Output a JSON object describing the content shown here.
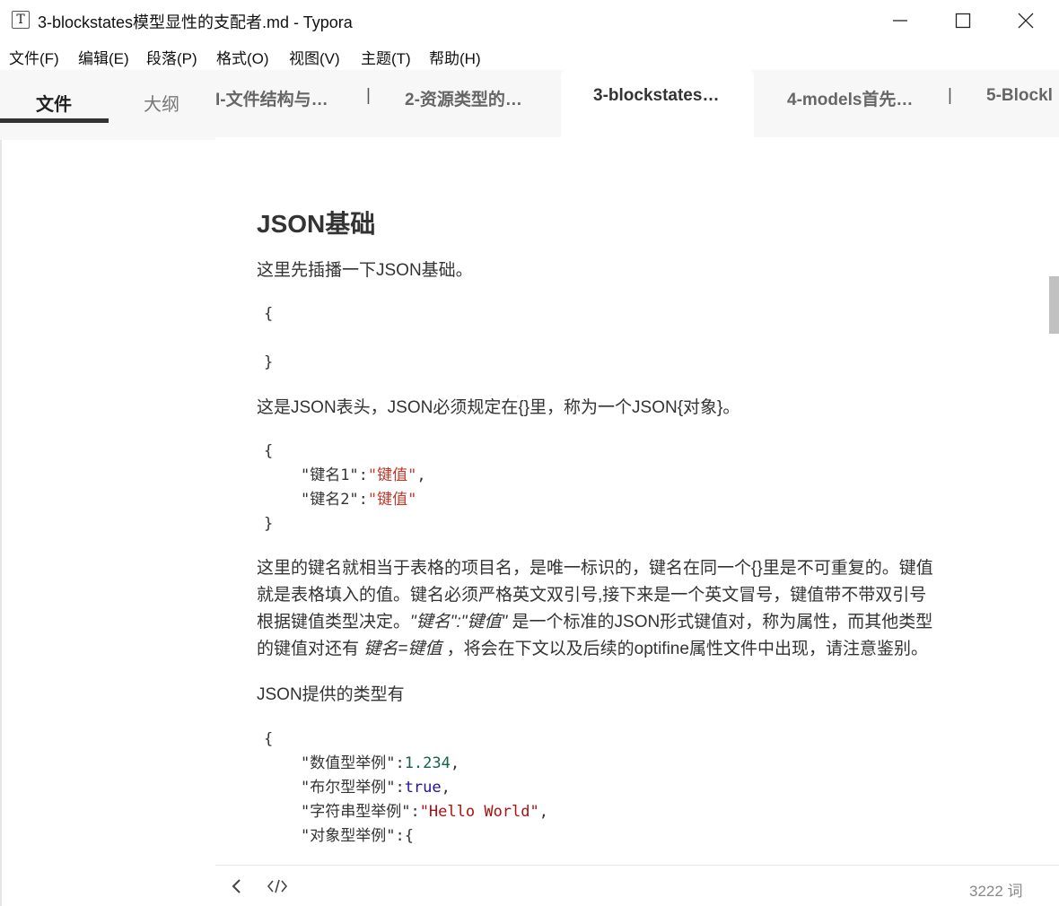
{
  "window": {
    "app_icon_letter": "T",
    "title": "3-blockstates模型显性的支配者.md - Typora"
  },
  "menu": [
    "文件(F)",
    "编辑(E)",
    "段落(P)",
    "格式(O)",
    "视图(V)",
    "主题(T)",
    "帮助(H)"
  ],
  "sidebar": {
    "tab_files": "文件",
    "tab_outline": "大纲"
  },
  "tabs": [
    {
      "label": "I-文件结构与…",
      "active": false
    },
    {
      "label": "2-资源类型的…",
      "active": false
    },
    {
      "label": "3-blockstates…",
      "active": true
    },
    {
      "label": "4-models首先…",
      "active": false
    },
    {
      "label": "5-Blockl",
      "active": false
    }
  ],
  "tab_separator": "|",
  "document": {
    "heading": "JSON基础",
    "p1": "这里先插播一下JSON基础。",
    "code1": {
      "open": "{",
      "close": "}"
    },
    "p2": "这是JSON表头，JSON必须规定在{}里，称为一个JSON{对象}。",
    "code2": {
      "open": "{",
      "k1": "\"键名1\"",
      "colon": ":",
      "v1": "\"键值\"",
      "comma": ",",
      "k2": "\"键名2\"",
      "v2": "\"键值\"",
      "close": "}"
    },
    "p3_line1": "这里的键名就相当于表格的项目名，是唯一标识的，键名在同一个{}里是不可重复的。键值",
    "p3_line2": "就是表格填入的值。键名必须严格英文双引号,接下来是一个英文冒号，键值带不带双引号",
    "p3_line3_pre": "根据键值类型决定。",
    "p3_line3_em": "\"键名\":\"键值\"",
    "p3_line3_post": " 是一个标准的JSON形式键值对，称为属性，而其他类型",
    "p3_line4_pre": "的键值对还有 ",
    "p3_line4_em": "键名=键值",
    "p3_line4_post": " ，将会在下文以及后续的optifine属性文件中出现，请注意鉴别。",
    "p4": "JSON提供的类型有",
    "code3": {
      "open": "{",
      "k_num": "\"数值型举例\"",
      "v_num": "1.234",
      "k_bool": "\"布尔型举例\"",
      "v_bool": "true",
      "k_str": "\"字符串型举例\"",
      "v_str": "\"Hello World\"",
      "k_obj": "\"对象型举例\"",
      "v_obj": "{"
    }
  },
  "status": {
    "word_count": "3222 词"
  }
}
